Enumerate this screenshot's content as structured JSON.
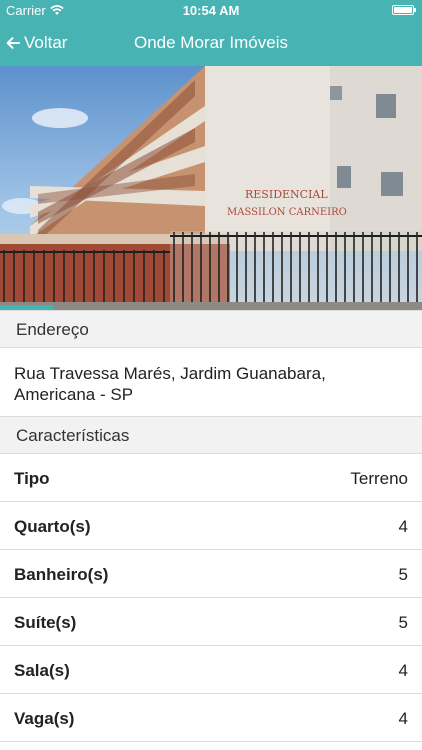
{
  "status_bar": {
    "carrier": "Carrier",
    "time": "10:54 AM"
  },
  "nav": {
    "back_label": "Voltar",
    "title": "Onde Morar Imóveis"
  },
  "photo": {
    "sign_line1": "RESIDENCIAL",
    "sign_line2": "MASSILON CARNEIRO",
    "progress_fraction": 0.125
  },
  "sections": {
    "address_header": "Endereço",
    "address_text": "Rua Travessa Marés, Jardim Guanabara, Americana - SP",
    "features_header": "Características"
  },
  "features": [
    {
      "label": "Tipo",
      "value": "Terreno"
    },
    {
      "label": "Quarto(s)",
      "value": "4"
    },
    {
      "label": "Banheiro(s)",
      "value": "5"
    },
    {
      "label": "Suíte(s)",
      "value": "5"
    },
    {
      "label": "Sala(s)",
      "value": "4"
    },
    {
      "label": "Vaga(s)",
      "value": "4"
    }
  ],
  "colors": {
    "accent": "#48b3b3",
    "section_bg": "#f2f2f2"
  }
}
